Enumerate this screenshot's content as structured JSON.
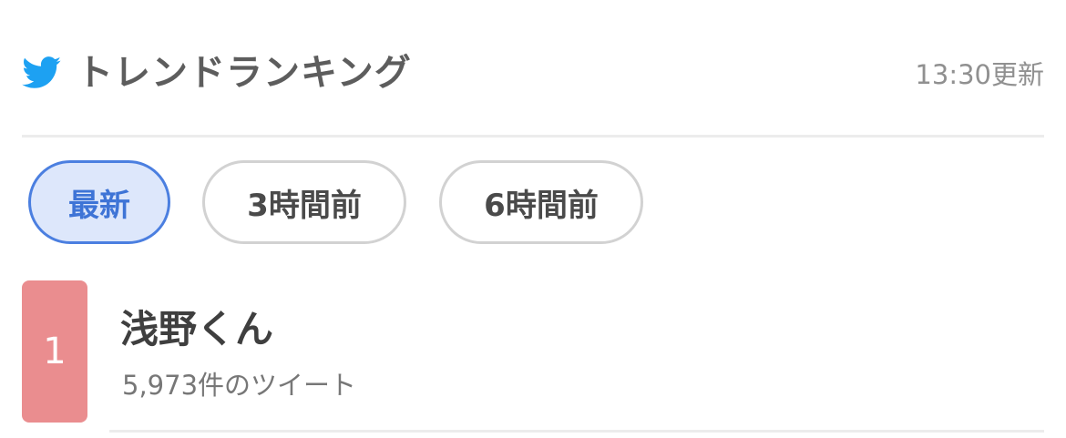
{
  "header": {
    "icon": "twitter-bird-icon",
    "title": "トレンドランキング",
    "updated": "13:30更新"
  },
  "tabs": [
    {
      "label": "最新",
      "active": true
    },
    {
      "label": "3時間前",
      "active": false
    },
    {
      "label": "6時間前",
      "active": false
    }
  ],
  "trends": [
    {
      "rank": "1",
      "name": "浅野くん",
      "count": "5,973件のツイート"
    }
  ],
  "colors": {
    "accent": "#4b7fe0",
    "active_tab_bg": "#dde7fb",
    "rank_badge": "#ea8d8f",
    "twitter_blue": "#1da1f2"
  }
}
